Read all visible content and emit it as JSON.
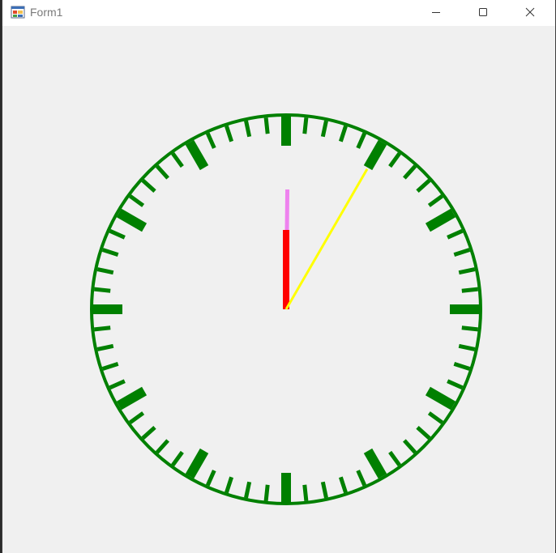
{
  "window": {
    "title": "Form1",
    "icon": "form-app-icon",
    "buttons": {
      "minimize": "minimize-icon",
      "maximize": "maximize-icon",
      "close": "close-icon"
    }
  },
  "clock": {
    "face_color": "#008000",
    "background": "#f0f0f0",
    "minute_ticks": 60,
    "hands": {
      "hour": {
        "color": "#ff0000",
        "position_hours": 0.0
      },
      "minute": {
        "color": "#ee82ee",
        "position_minutes": 0.1
      },
      "second": {
        "color": "#ffff00",
        "position_seconds": 5.0
      }
    }
  }
}
